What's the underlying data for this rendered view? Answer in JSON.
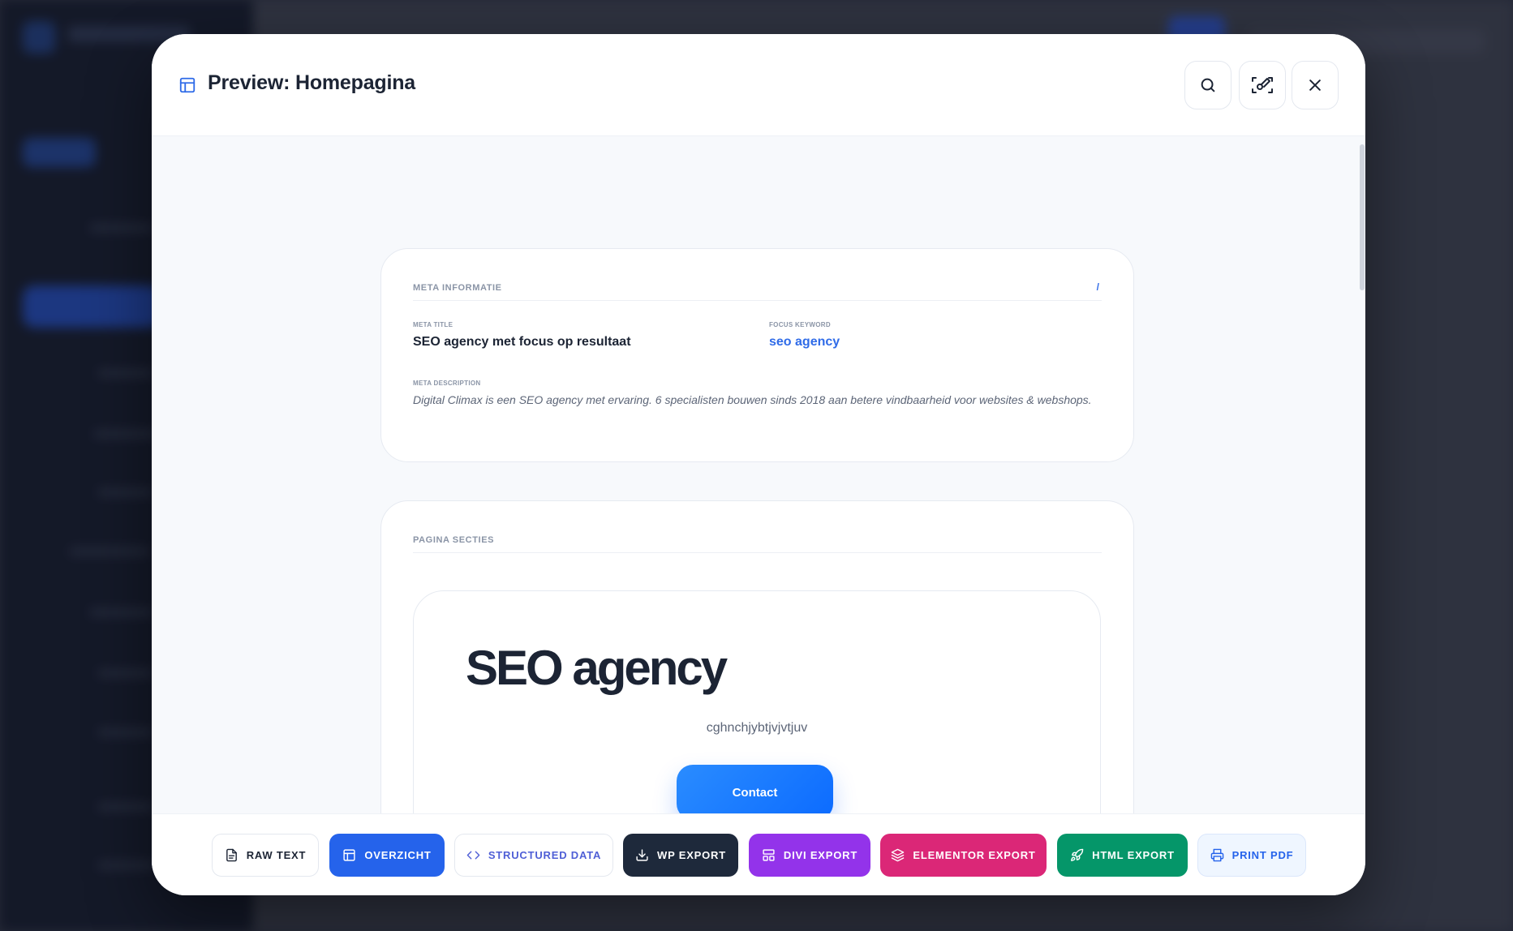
{
  "modal": {
    "title": "Preview: Homepagina"
  },
  "meta": {
    "section_label": "META INFORMATIE",
    "edit_mark": "/",
    "meta_title_label": "META TITLE",
    "meta_title_value": "SEO agency met focus op resultaat",
    "focus_keyword_label": "FOCUS KEYWORD",
    "focus_keyword_value": "seo agency",
    "meta_description_label": "META DESCRIPTION",
    "meta_description_value": "Digital Climax is een SEO agency met ervaring. 6 specialisten bouwen sinds 2018 aan betere vindbaarheid voor websites & webshops."
  },
  "sections": {
    "section_label": "PAGINA SECTIES",
    "hero": {
      "title": "SEO agency",
      "subtitle": "cghnchjybtjvjvtjuv",
      "button_label": "Contact"
    }
  },
  "footer": {
    "buttons": [
      {
        "label": "RAW TEXT",
        "icon": "file-text-icon"
      },
      {
        "label": "OVERZICHT",
        "icon": "layout-icon"
      },
      {
        "label": "STRUCTURED DATA",
        "icon": "code-icon"
      },
      {
        "label": "WP EXPORT",
        "icon": "download-icon"
      },
      {
        "label": "DIVI EXPORT",
        "icon": "layout-grid-icon"
      },
      {
        "label": "ELEMENTOR EXPORT",
        "icon": "layers-icon"
      },
      {
        "label": "HTML EXPORT",
        "icon": "rocket-icon"
      },
      {
        "label": "PRINT PDF",
        "icon": "printer-icon"
      }
    ]
  },
  "colors": {
    "accent_blue": "#2563eb",
    "wp_dark": "#1e293b",
    "divi_purple": "#9333ea",
    "elementor_pink": "#db2777",
    "html_green": "#059669",
    "print_light": "#eff6ff"
  }
}
